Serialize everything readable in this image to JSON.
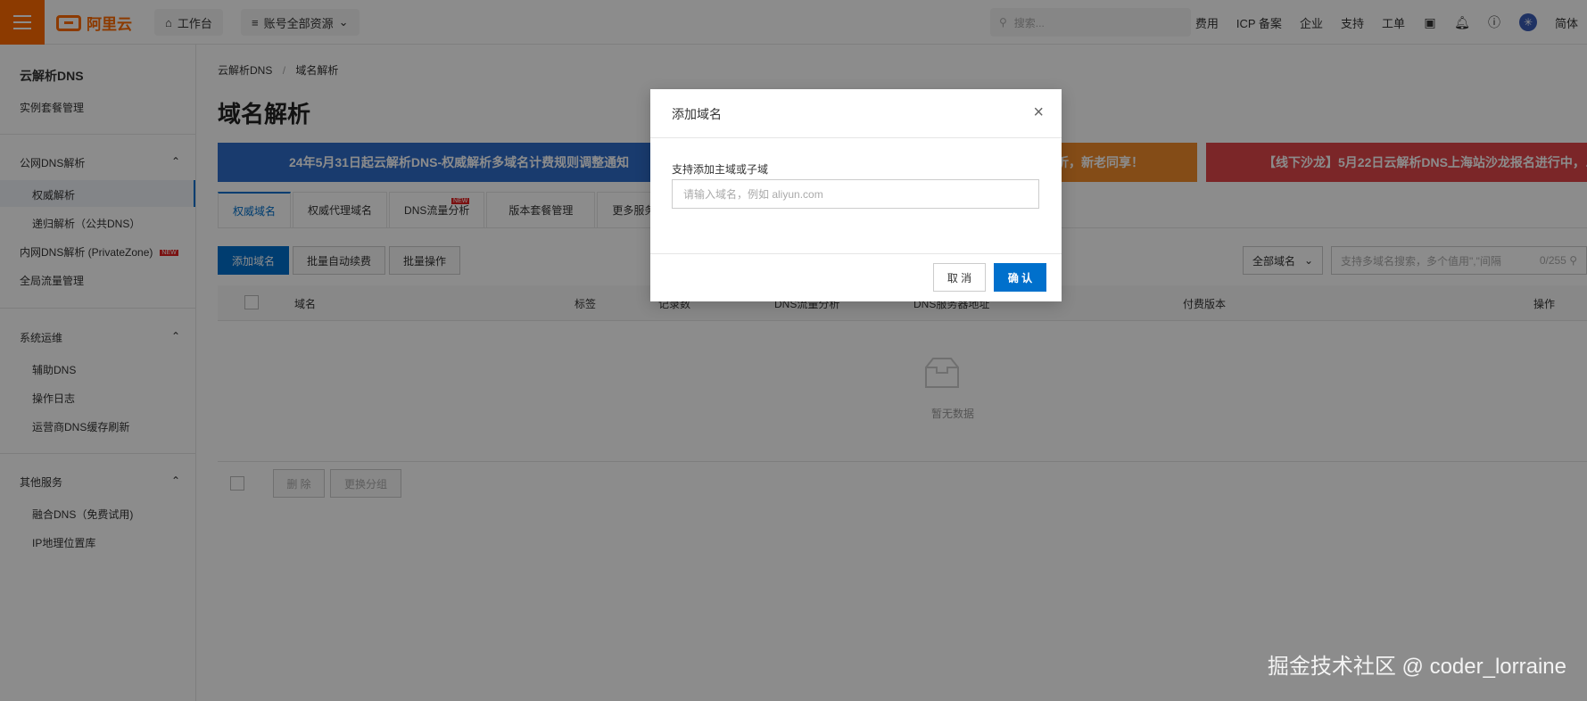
{
  "topbar": {
    "brand": "阿里云",
    "workbench": "工作台",
    "resources": "账号全部资源",
    "search_placeholder": "搜索...",
    "links": [
      "费用",
      "ICP 备案",
      "企业",
      "支持",
      "工单"
    ],
    "avatar_glyph": "✳",
    "lang": "简体"
  },
  "sidebar": {
    "title": "云解析DNS",
    "instance_mgmt": "实例套餐管理",
    "group_public": "公网DNS解析",
    "item_authoritative": "权威解析",
    "item_recursive": "递归解析（公共DNS）",
    "item_private": "内网DNS解析 (PrivateZone)",
    "item_private_tag": "NEW",
    "item_global": "全局流量管理",
    "group_ops": "系统运维",
    "item_aux": "辅助DNS",
    "item_log": "操作日志",
    "item_cache": "运营商DNS缓存刷新",
    "group_other": "其他服务",
    "item_fusion": "融合DNS（免费试用)",
    "item_ipgeo": "IP地理位置库"
  },
  "main": {
    "breadcrumb": [
      "云解析DNS",
      "/",
      "域名解析"
    ],
    "title": "域名解析",
    "banners": [
      "24年5月31日起云解析DNS-权威解析多域名计费规则调整通知",
      "5折，新老同享！",
      "【线下沙龙】5月22日云解析DNS上海站沙龙报名进行中，…"
    ],
    "tabs": [
      "权威域名",
      "权威代理域名",
      "DNS流量分析",
      "版本套餐管理",
      "更多服务"
    ],
    "tab_new": "NEW",
    "buttons": {
      "add": "添加域名",
      "renew": "批量自动续费",
      "batch": "批量操作"
    },
    "filter_select": "全部域名",
    "filter_placeholder": "支持多域名搜索，多个值用\",\"间隔",
    "filter_count": "0/255",
    "columns": [
      "域名",
      "标签",
      "记录数",
      "DNS流量分析",
      "DNS服务器地址",
      "付费版本",
      "操作"
    ],
    "empty": "暂无数据",
    "footer_buttons": {
      "delete": "删 除",
      "group": "更换分组"
    }
  },
  "modal": {
    "title": "添加域名",
    "label": "支持添加主域或子域",
    "placeholder": "请输入域名，例如 aliyun.com",
    "cancel": "取 消",
    "confirm": "确 认"
  },
  "watermark": "掘金技术社区 @ coder_lorraine",
  "colors": {
    "brand": "#ff6a00",
    "primary": "#0070cc",
    "banner1": "#2f6cc8",
    "banner2": "#f08a2a",
    "banner3": "#e0464a"
  }
}
